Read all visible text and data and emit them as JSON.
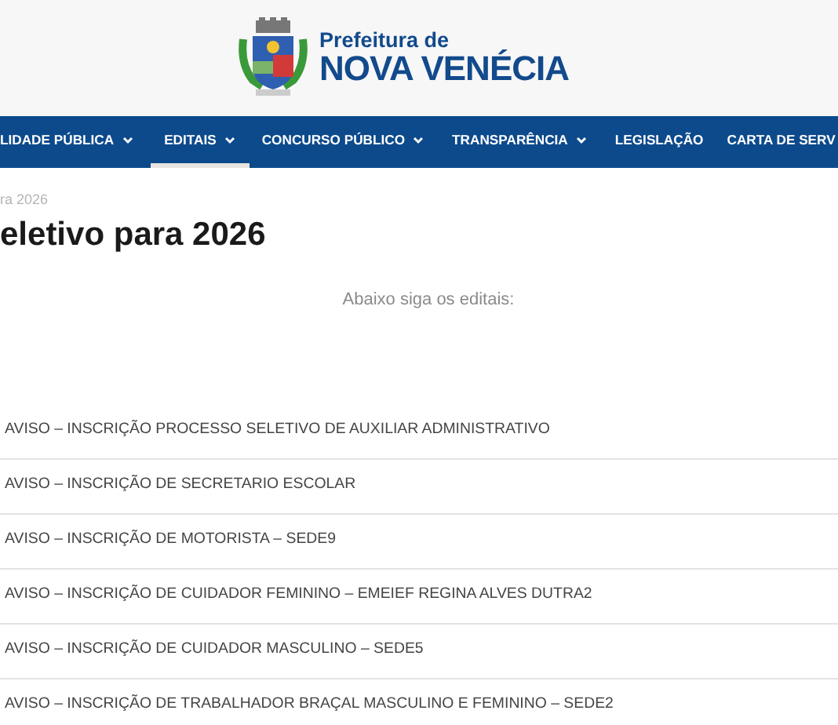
{
  "header": {
    "logo_line_1": "Prefeitura de",
    "logo_line_2": "NOVA VENÉCIA"
  },
  "nav": [
    {
      "label": "LIDADE PÚBLICA",
      "dropdown": true,
      "selected": false
    },
    {
      "label": "EDITAIS",
      "dropdown": true,
      "selected": true
    },
    {
      "label": "CONCURSO PÚBLICO",
      "dropdown": true,
      "selected": false
    },
    {
      "label": "TRANSPARÊNCIA",
      "dropdown": true,
      "selected": false
    },
    {
      "label": "LEGISLAÇÃO",
      "dropdown": false,
      "selected": false
    },
    {
      "label": "CARTA DE SERV",
      "dropdown": false,
      "selected": false
    }
  ],
  "breadcrumb": "ra 2026",
  "title": "eletivo para 2026",
  "intro": "Abaixo siga os editais:",
  "notices": [
    "AVISO – INSCRIÇÃO PROCESSO SELETIVO DE AUXILIAR ADMINISTRATIVO",
    "AVISO – INSCRIÇÃO DE SECRETARIO ESCOLAR",
    "AVISO – INSCRIÇÃO DE MOTORISTA – SEDE9",
    "AVISO – INSCRIÇÃO DE CUIDADOR FEMININO – EMEIEF REGINA ALVES DUTRA2",
    "AVISO – INSCRIÇÃO DE CUIDADOR MASCULINO – SEDE5",
    "AVISO – INSCRIÇÃO DE TRABALHADOR BRAÇAL MASCULINO E FEMININO – SEDE2"
  ]
}
